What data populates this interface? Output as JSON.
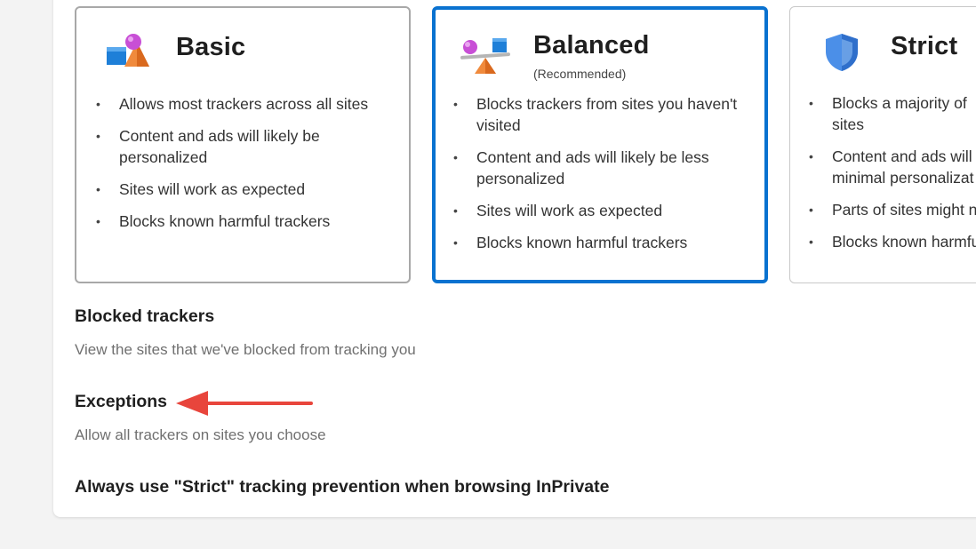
{
  "cards": [
    {
      "title": "Basic",
      "subtitle": "",
      "bullets": [
        "Allows most trackers across all sites",
        "Content and ads will likely be personalized",
        "Sites will work as expected",
        "Blocks known harmful trackers"
      ]
    },
    {
      "title": "Balanced",
      "subtitle": "(Recommended)",
      "selected": true,
      "bullets": [
        "Blocks trackers from sites you haven't visited",
        "Content and ads will likely be less personalized",
        "Sites will work as expected",
        "Blocks known harmful trackers"
      ]
    },
    {
      "title": "Strict",
      "subtitle": "",
      "bullets": [
        "Blocks a majority of",
        "sites",
        "Content and ads will",
        "minimal personalizat",
        "Parts of sites might n",
        "Blocks known harmfu"
      ]
    }
  ],
  "bullet_char": "•",
  "sections": {
    "blocked_trackers": {
      "title": "Blocked trackers",
      "description": "View the sites that we've blocked from tracking you"
    },
    "exceptions": {
      "title": "Exceptions",
      "description": "Allow all trackers on sites you choose"
    },
    "inprivate": {
      "title": "Always use \"Strict\" tracking prevention when browsing InPrivate"
    }
  },
  "annotation": {
    "arrow_color": "#e8453c"
  },
  "colors": {
    "selected_border": "#0a72d0"
  }
}
